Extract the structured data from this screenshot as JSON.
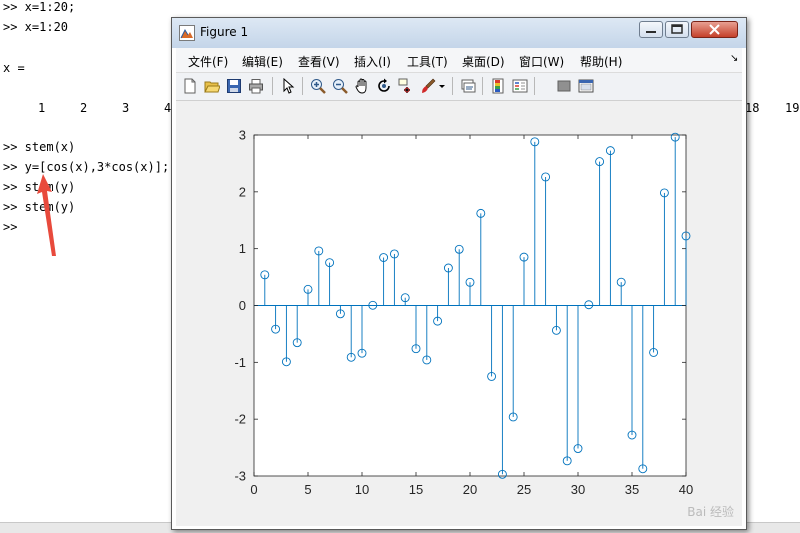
{
  "command_window": {
    "lines": [
      ">> x=1:20;",
      ">> x=1:20",
      "x =",
      ">> stem(x)",
      ">> y=[cos(x),3*cos(x)];",
      ">> stem(y)",
      ">> stem(y)",
      ">>"
    ],
    "vector_values_left": [
      "1",
      "2",
      "3",
      "4"
    ],
    "vector_values_right": [
      "18",
      "19"
    ],
    "annotation_color": "#e84a3c"
  },
  "figure_window": {
    "title": "Figure 1",
    "menu": [
      "文件(F)",
      "编辑(E)",
      "查看(V)",
      "插入(I)",
      "工具(T)",
      "桌面(D)",
      "窗口(W)",
      "帮助(H)"
    ],
    "menu_overflow": "↘",
    "toolbar_icons": [
      "new-figure-icon",
      "open-file-icon",
      "save-icon",
      "print-icon",
      "pointer-icon",
      "zoom-in-icon",
      "zoom-out-icon",
      "pan-hand-icon",
      "rotate-3d-icon",
      "data-cursor-icon",
      "brush-icon",
      "brush-dropdown-icon",
      "link-plot-icon",
      "colorbar-icon",
      "legend-icon",
      "hide-plot-tools-icon",
      "show-plot-tools-icon"
    ]
  },
  "chart_data": {
    "type": "stem",
    "x": [
      1,
      2,
      3,
      4,
      5,
      6,
      7,
      8,
      9,
      10,
      11,
      12,
      13,
      14,
      15,
      16,
      17,
      18,
      19,
      20,
      21,
      22,
      23,
      24,
      25,
      26,
      27,
      28,
      29,
      30,
      31,
      32,
      33,
      34,
      35,
      36,
      37,
      38,
      39,
      40
    ],
    "values": [
      0.54,
      -0.416,
      -0.99,
      -0.654,
      0.284,
      0.96,
      0.754,
      -0.146,
      -0.911,
      -0.839,
      0.004,
      0.844,
      0.907,
      0.137,
      -0.76,
      -0.958,
      -0.275,
      0.66,
      0.989,
      0.408,
      1.621,
      -1.248,
      -2.97,
      -1.961,
      0.851,
      2.88,
      2.262,
      -0.437,
      -2.733,
      -2.517,
      0.013,
      2.532,
      2.725,
      0.411,
      -2.279,
      -2.873,
      -0.826,
      1.981,
      2.962,
      1.224
    ],
    "xlim": [
      0,
      40
    ],
    "ylim": [
      -3,
      3
    ],
    "xticks": [
      "0",
      "5",
      "10",
      "15",
      "20",
      "25",
      "30",
      "35",
      "40"
    ],
    "yticks": [
      "-3",
      "-2",
      "-1",
      "0",
      "1",
      "2",
      "3"
    ],
    "color": "#0072bd",
    "grid": false
  },
  "watermark": "Bai 经验"
}
